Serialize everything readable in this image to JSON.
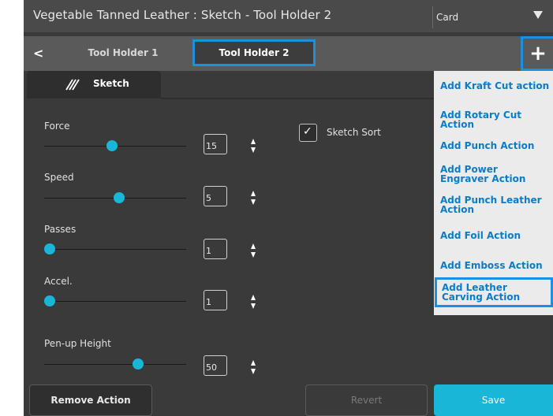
{
  "window": {
    "title": "Vegetable Tanned Leather : Sketch - Tool Holder 2"
  },
  "card_select": {
    "value": "Card"
  },
  "tabs": [
    {
      "label": "Tool Holder 1",
      "selected": false
    },
    {
      "label": "Tool Holder 2",
      "selected": true
    }
  ],
  "subtab": {
    "label": "Sketch"
  },
  "fields": [
    {
      "label": "Force",
      "value": "15",
      "slider_fraction": 0.44
    },
    {
      "label": "Speed",
      "value": "5",
      "slider_fraction": 0.49
    },
    {
      "label": "Passes",
      "value": "1",
      "slider_fraction": 0.0
    },
    {
      "label": "Accel.",
      "value": "1",
      "slider_fraction": 0.0
    },
    {
      "label": "Pen-up Height",
      "value": "50",
      "slider_fraction": 0.62
    }
  ],
  "sketch_sort": {
    "label": "Sketch Sort",
    "checked": true
  },
  "add_menu": {
    "items": [
      "Add Kraft Cut action",
      "Add Rotary Cut Action",
      "Add Punch Action",
      "Add Power Engraver Action",
      "Add Punch Leather Action",
      "Add Foil Action",
      "Add Emboss Action",
      "Add Leather Carving Action"
    ],
    "selected_index": 7
  },
  "buttons": {
    "remove": "Remove Action",
    "revert": "Revert",
    "save": "Save"
  },
  "colors": {
    "accent": "#1ab6d8",
    "highlight_border": "#1a90de",
    "menu_text": "#0a7cc8"
  }
}
